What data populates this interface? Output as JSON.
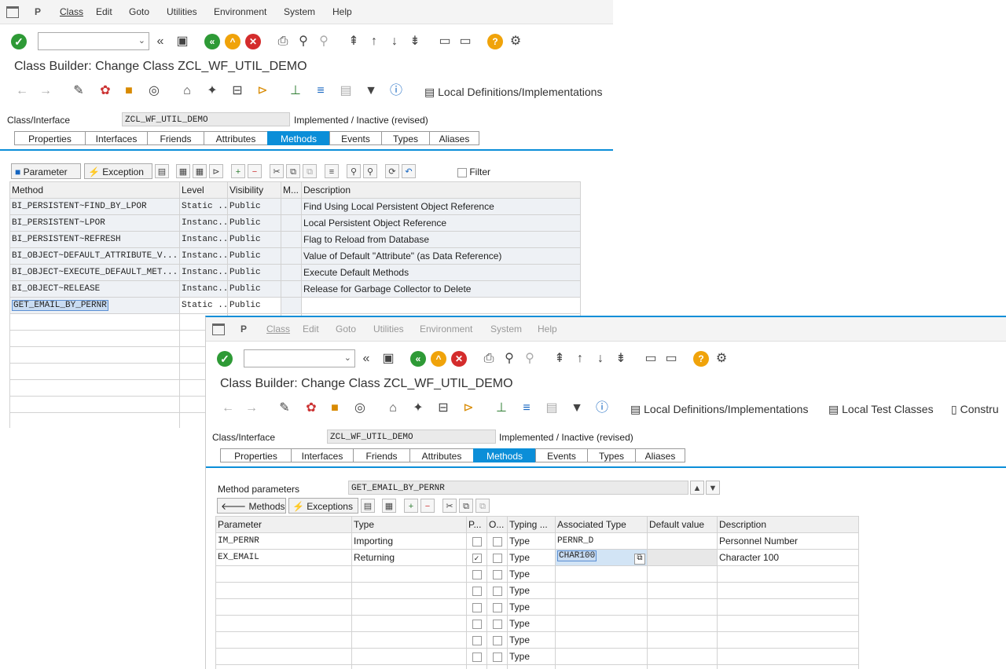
{
  "menu": [
    "Class",
    "Edit",
    "Goto",
    "Utilities",
    "Environment",
    "System",
    "Help"
  ],
  "title": "Class Builder: Change Class ZCL_WF_UTIL_DEMO",
  "local_defs": "Local Definitions/Implementations",
  "local_tests": "Local Test Classes",
  "constructor_trunc": "Constru",
  "class_iface": {
    "label": "Class/Interface",
    "value": "ZCL_WF_UTIL_DEMO",
    "status": "Implemented / Inactive (revised)"
  },
  "tabs": [
    "Properties",
    "Interfaces",
    "Friends",
    "Attributes",
    "Methods",
    "Events",
    "Types",
    "Aliases"
  ],
  "active_tab": "Methods",
  "back_window": {
    "toolbar": {
      "parameter": "Parameter",
      "exception": "Exception",
      "filter": "Filter"
    },
    "columns": [
      "Method",
      "Level",
      "Visibility",
      "M...",
      "Description"
    ],
    "rows": [
      {
        "method": "BI_PERSISTENT~FIND_BY_LPOR",
        "level": "Static ...",
        "vis": "Public",
        "desc": "Find Using Local Persistent Object Reference"
      },
      {
        "method": "BI_PERSISTENT~LPOR",
        "level": "Instanc...",
        "vis": "Public",
        "desc": "Local Persistent Object Reference"
      },
      {
        "method": "BI_PERSISTENT~REFRESH",
        "level": "Instanc...",
        "vis": "Public",
        "desc": "Flag to Reload from Database"
      },
      {
        "method": "BI_OBJECT~DEFAULT_ATTRIBUTE_V...",
        "level": "Instanc...",
        "vis": "Public",
        "desc": "Value of Default \"Attribute\" (as Data Reference)"
      },
      {
        "method": "BI_OBJECT~EXECUTE_DEFAULT_MET...",
        "level": "Instanc...",
        "vis": "Public",
        "desc": "Execute Default Methods"
      },
      {
        "method": "BI_OBJECT~RELEASE",
        "level": "Instanc...",
        "vis": "Public",
        "desc": "Release for Garbage Collector to Delete"
      },
      {
        "method": "GET_EMAIL_BY_PERNR",
        "level": "Static ...",
        "vis": "Public",
        "desc": ""
      }
    ]
  },
  "front_window": {
    "method_params_label": "Method parameters",
    "method_params_value": "GET_EMAIL_BY_PERNR",
    "toolbar": {
      "methods": "Methods",
      "exceptions": "Exceptions"
    },
    "columns": [
      "Parameter",
      "Type",
      "P...",
      "O...",
      "Typing ...",
      "Associated Type",
      "Default value",
      "Description"
    ],
    "rows": [
      {
        "param": "IM_PERNR",
        "type": "Importing",
        "p": false,
        "o": false,
        "typing": "Type",
        "assoc": "PERNR_D",
        "default": "",
        "desc": "Personnel Number"
      },
      {
        "param": "EX_EMAIL",
        "type": "Returning",
        "p": true,
        "o": false,
        "typing": "Type",
        "assoc": "CHAR100",
        "default": "",
        "desc": "Character 100"
      }
    ],
    "empty_typing": "Type"
  },
  "colors": {
    "accent": "#0b8ed8",
    "ok": "#2e9a36",
    "cancel": "#d42c2c",
    "nav": "#2e9a36",
    "up": "#f0a30a",
    "help": "#f0a30a"
  }
}
